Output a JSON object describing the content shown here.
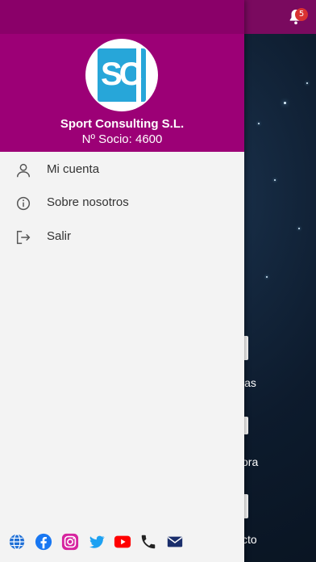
{
  "notifications": {
    "count": "5"
  },
  "background": {
    "items": [
      {
        "label": "ias"
      },
      {
        "label": "ora"
      },
      {
        "label": "cto"
      }
    ]
  },
  "drawer": {
    "logo_text": "SC",
    "company_name": "Sport Consulting S.L.",
    "member_number": "Nº Socio: 4600",
    "menu": [
      {
        "label": "Mi cuenta",
        "icon": "user-icon"
      },
      {
        "label": "Sobre nosotros",
        "icon": "info-icon"
      },
      {
        "label": "Salir",
        "icon": "logout-icon"
      }
    ],
    "social": [
      "globe-icon",
      "facebook-icon",
      "instagram-icon",
      "twitter-icon",
      "youtube-icon",
      "phone-icon",
      "mail-icon"
    ]
  },
  "colors": {
    "header_magenta": "#9c0076",
    "top_bar": "#8a0069",
    "logo_blue": "#27a6d9",
    "badge_red": "#d93232"
  }
}
